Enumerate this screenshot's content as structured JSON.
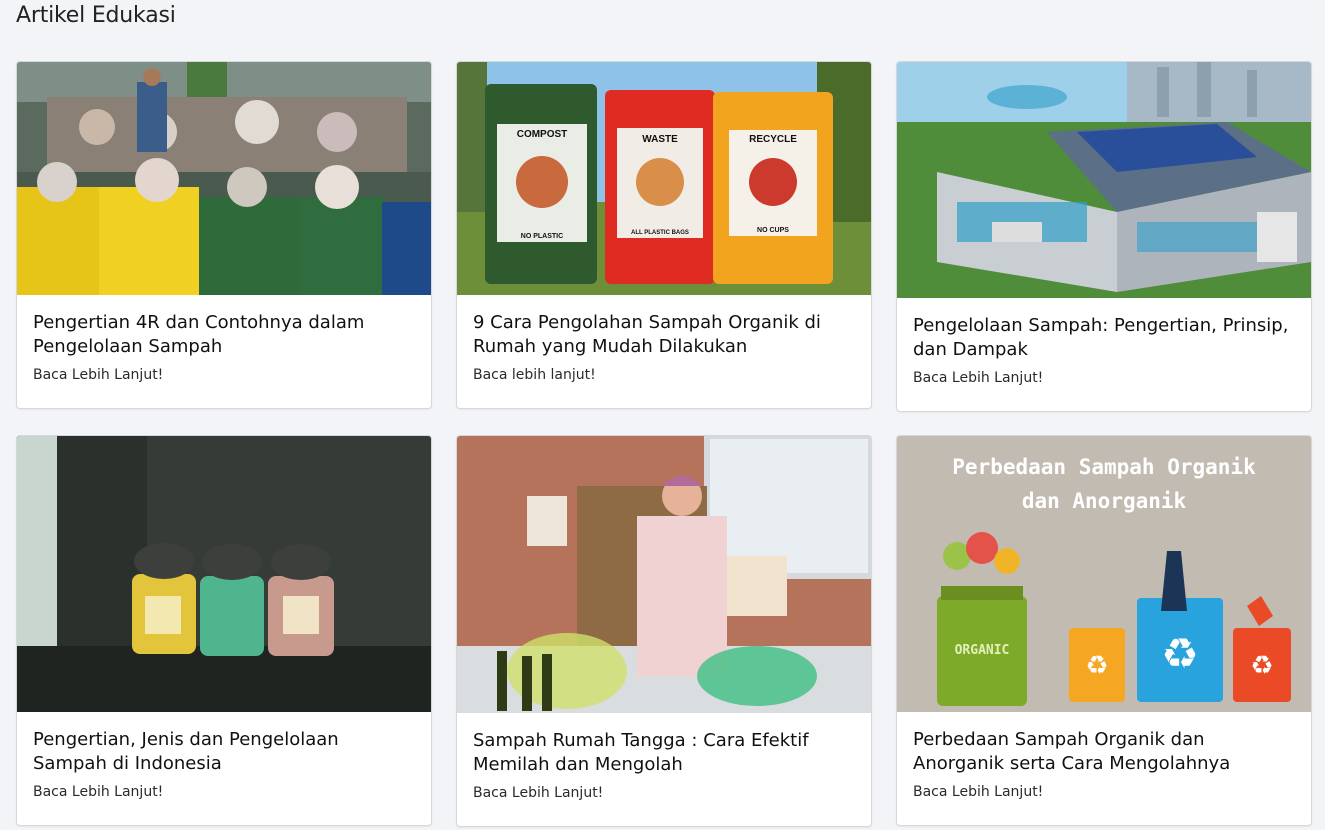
{
  "page": {
    "title": "Artikel Edukasi"
  },
  "cards": [
    {
      "title": "Pengertian 4R dan Contohnya dalam Pengelolaan Sampah",
      "link": "Baca Lebih Lanjut!",
      "image": "recycling-bins-photo"
    },
    {
      "title": "9 Cara Pengolahan Sampah Organik di Rumah yang Mudah Dilakukan",
      "link": "Baca lebih lanjut!",
      "image": "compost-waste-recycle-bins-photo",
      "bin_labels": [
        "COMPOST",
        "WASTE",
        "RECYCLE"
      ],
      "bin_sublabels": [
        "NO PLASTIC",
        "ALL PLASTIC BAGS",
        "NO CUPS"
      ]
    },
    {
      "title": "Pengelolaan Sampah: Pengertian, Prinsip, dan Dampak",
      "link": "Baca Lebih Lanjut!",
      "image": "waste-facility-illustration"
    },
    {
      "title": "Pengertian, Jenis dan Pengelolaan Sampah di Indonesia",
      "link": "Baca Lebih Lanjut!",
      "image": "wall-trash-bins-rain-photo"
    },
    {
      "title": "Sampah Rumah Tangga : Cara Efektif Memilah dan Mengolah",
      "link": "Baca Lebih Lanjut!",
      "image": "woman-sorting-waste-photo"
    },
    {
      "title": "Perbedaan Sampah Organik dan Anorganik serta Cara Mengolahnya",
      "link": "Baca Lebih Lanjut!",
      "image": "organic-anorganic-poster",
      "poster_title_line1": "Perbedaan Sampah Organik",
      "poster_title_line2": "dan Anorganik",
      "poster_bin_label": "ORGANIC"
    }
  ]
}
